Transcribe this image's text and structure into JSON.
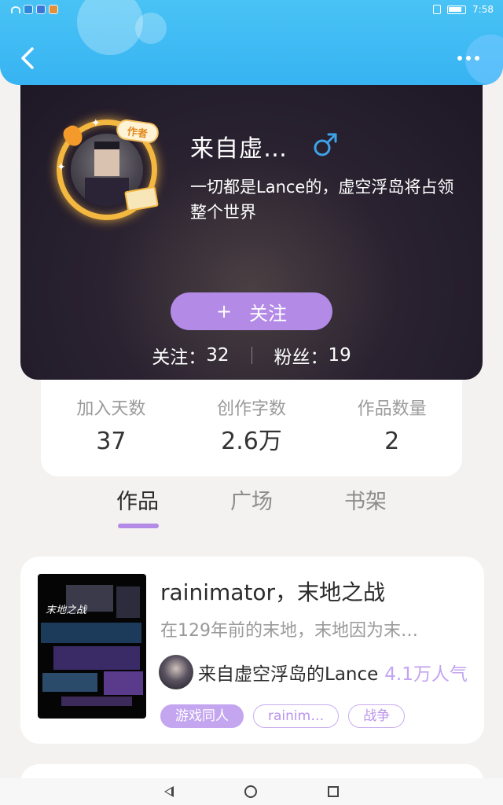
{
  "status_bar": {
    "time": "7:58"
  },
  "header": {
    "back_icon": "chevron-left-icon",
    "more_icon": "more-dots-icon"
  },
  "profile": {
    "author_badge": "作者",
    "username": "来自虚…",
    "gender_symbol": "♂",
    "bio": "一切都是Lance的，虚空浮岛将占领整个世界",
    "follow_button": {
      "plus": "+",
      "label": "关注"
    },
    "following_label": "关注：",
    "following_count": "32",
    "fans_label": "粉丝：",
    "fans_count": "19",
    "colors": {
      "gender": "#3da2e8",
      "follow_button": "#b38ae6"
    }
  },
  "stats": [
    {
      "label": "加入天数",
      "value": "37"
    },
    {
      "label": "创作字数",
      "value": "2.6万"
    },
    {
      "label": "作品数量",
      "value": "2"
    }
  ],
  "tabs": [
    {
      "label": "作品",
      "active": true
    },
    {
      "label": "广场",
      "active": false
    },
    {
      "label": "书架",
      "active": false
    }
  ],
  "work": {
    "cover_text": "末地之战",
    "title": "rainimator，末地之战",
    "description": "在129年前的末地，末地因为末…",
    "author_name": "来自虚空浮岛的Lance",
    "popularity": "4.1万人气",
    "tags": [
      {
        "label": "游戏同人",
        "style": "filled"
      },
      {
        "label": "rainim…",
        "style": "outline"
      },
      {
        "label": "战争",
        "style": "outline"
      }
    ],
    "colors": {
      "popularity": "#c2a4ef",
      "tag_filled": "#c4a6f0"
    }
  },
  "colors": {
    "header": "#49c3f5",
    "accent": "#b38ae6",
    "background": "#f4f2f0"
  }
}
